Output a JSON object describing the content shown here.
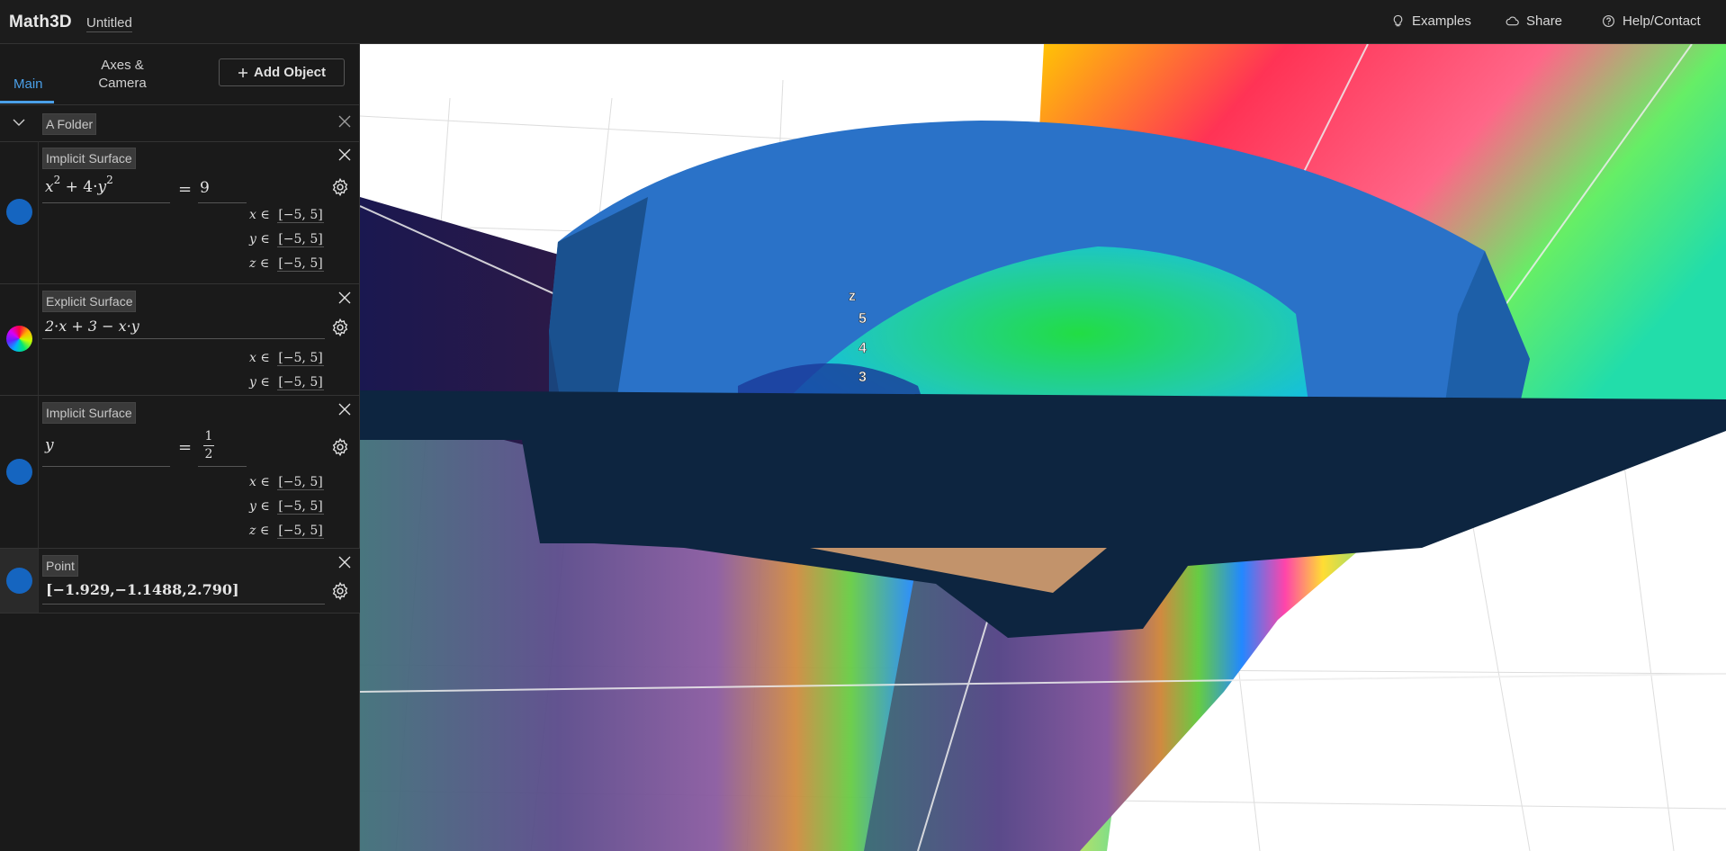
{
  "app": {
    "brand": "Math3D",
    "doc_title": "Untitled"
  },
  "header": {
    "examples": {
      "label": "Examples",
      "icon": "lightbulb-icon"
    },
    "share": {
      "label": "Share",
      "icon": "cloud-icon"
    },
    "help": {
      "label": "Help/Contact",
      "icon": "question-circle-icon"
    }
  },
  "sidebar": {
    "tabs": [
      {
        "label": "Main",
        "active": true
      },
      {
        "label_line1": "Axes &",
        "label_line2": "Camera",
        "active": false
      }
    ],
    "add_object": "Add Object",
    "folder": {
      "label": "A Folder"
    },
    "objects": [
      {
        "type_label": "Implicit Surface",
        "color": "#1565c0",
        "lhs_base1": "x",
        "lhs_exp1": "2",
        "lhs_mid": " + 4·",
        "lhs_base2": "y",
        "lhs_exp2": "2",
        "rhs": "9",
        "ranges": [
          {
            "var": "x",
            "value": "[−5, 5]"
          },
          {
            "var": "y",
            "value": "[−5, 5]"
          },
          {
            "var": "z",
            "value": "[−5, 5]"
          }
        ]
      },
      {
        "type_label": "Explicit Surface",
        "color": "rainbow",
        "expr": "2·x + 3 − x·y",
        "ranges": [
          {
            "var": "x",
            "value": "[−5, 5]"
          },
          {
            "var": "y",
            "value": "[−5, 5]"
          }
        ]
      },
      {
        "type_label": "Implicit Surface",
        "color": "#1565c0",
        "lhs": "y",
        "rhs_num": "1",
        "rhs_den": "2",
        "ranges": [
          {
            "var": "x",
            "value": "[−5, 5]"
          },
          {
            "var": "y",
            "value": "[−5, 5]"
          },
          {
            "var": "z",
            "value": "[−5, 5]"
          }
        ]
      },
      {
        "type_label": "Point",
        "color": "#1565c0",
        "coords": "[−1.929,−1.1488,2.790]"
      }
    ]
  },
  "scene": {
    "axis_labels": {
      "z": "z",
      "t5": "5",
      "t4": "4",
      "t3": "3"
    },
    "surface_blue": "#2a72c8",
    "surface_dark": "#0d2540"
  }
}
